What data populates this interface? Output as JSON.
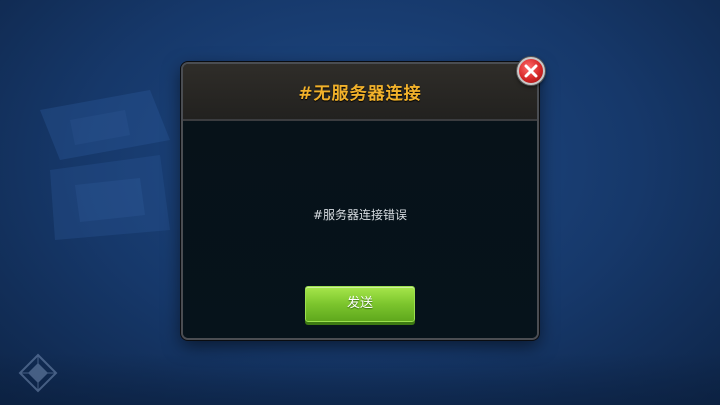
{
  "dialog": {
    "title": "#无服务器连接",
    "message": "#服务器连接错误",
    "send_button_label": "发送"
  },
  "icons": {
    "close": "close-icon",
    "background_logo": "game-logo-watermark",
    "corner": "corner-emblem-icon"
  },
  "colors": {
    "title": "#f1b12b",
    "button": "#7cc52d",
    "close": "#d62828",
    "background": "#1a3f78"
  }
}
